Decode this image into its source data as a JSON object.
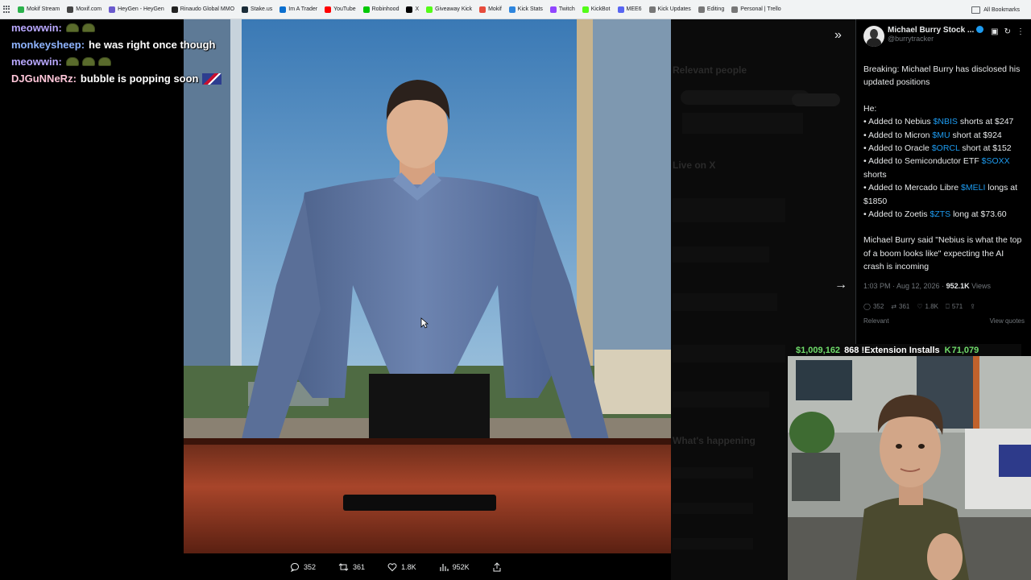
{
  "bookmarks": {
    "items": [
      {
        "label": "Mokif Stream",
        "color": "#2bb24c"
      },
      {
        "label": "Moxif.com",
        "color": "#444444"
      },
      {
        "label": "HeyGen - HeyGen",
        "color": "#6a5acd"
      },
      {
        "label": "Rinaudo Global MMO",
        "color": "#222222"
      },
      {
        "label": "Stake.us",
        "color": "#1a2c38"
      },
      {
        "label": "Im A Trader",
        "color": "#0b6fcf"
      },
      {
        "label": "YouTube",
        "color": "#ff0000"
      },
      {
        "label": "Robinhood",
        "color": "#00c805"
      },
      {
        "label": "X",
        "color": "#000000"
      },
      {
        "label": "Giveaway Kick",
        "color": "#53fc18"
      },
      {
        "label": "Mokif",
        "color": "#e74c3c"
      },
      {
        "label": "Kick Stats",
        "color": "#2e86de"
      },
      {
        "label": "Twitch",
        "color": "#9146ff"
      },
      {
        "label": "KickBot",
        "color": "#53fc18"
      },
      {
        "label": "MEE6",
        "color": "#5865f2"
      },
      {
        "label": "Kick Updates",
        "color": "#777777"
      },
      {
        "label": "Editing",
        "color": "#777777"
      },
      {
        "label": "Personal | Trello",
        "color": "#777777"
      }
    ],
    "all_bookmarks": "All Bookmarks"
  },
  "chat": [
    {
      "user": "meowwin:",
      "user_color": "#b9a8ff",
      "message": "",
      "emotes": 2,
      "flag": false
    },
    {
      "user": "monkeysheep:",
      "user_color": "#8fb4ff",
      "message": "he was right once though",
      "emotes": 0,
      "flag": false
    },
    {
      "user": "meowwin:",
      "user_color": "#b9a8ff",
      "message": "",
      "emotes": 3,
      "flag": false
    },
    {
      "user": "DJGuNNeRz:",
      "user_color": "#ffc6d9",
      "message": "bubble is popping soon",
      "emotes": 0,
      "flag": true
    }
  ],
  "media_actions": {
    "replies": "352",
    "reposts": "361",
    "likes": "1.8K",
    "views": "952K"
  },
  "tweet": {
    "name": "Michael Burry Stock ...",
    "handle": "@burrytracker",
    "intro": "Breaking: Michael Burry has disclosed his updated positions",
    "he": "He:",
    "positions": [
      {
        "pre": "• Added to Nebius ",
        "cash": "$NBIS",
        "post": " shorts at $247"
      },
      {
        "pre": "• Added to Micron ",
        "cash": "$MU",
        "post": " short at $924"
      },
      {
        "pre": "• Added to Oracle ",
        "cash": "$ORCL",
        "post": " short at $152"
      },
      {
        "pre": "• Added to Semiconductor ETF ",
        "cash": "$SOXX",
        "post": " shorts"
      },
      {
        "pre": "• Added to Mercado Libre ",
        "cash": "$MELI",
        "post": " longs at $1850"
      },
      {
        "pre": "• Added to Zoetis ",
        "cash": "$ZTS",
        "post": " long at $73.60"
      }
    ],
    "quote": "Michael Burry said \"Nebius is what the top of a boom looks like\" expecting the AI crash is incoming",
    "time": "1:03 PM · Aug 12, 2026 · ",
    "views_count": "952.1K",
    "views_label": " Views",
    "actions": {
      "replies": "352",
      "reposts": "361",
      "likes": "1.8K",
      "bookmarks": "571"
    },
    "relevant": "Relevant",
    "view_quotes": "View quotes"
  },
  "ticker": {
    "balance": "$1,009,162",
    "count_label": "868 !Extension Installs",
    "kick": "71,079"
  },
  "background_ghost": {
    "relevant_people": "Relevant people",
    "live_on_x": "Live on X",
    "whats_happening": "What's happening"
  }
}
